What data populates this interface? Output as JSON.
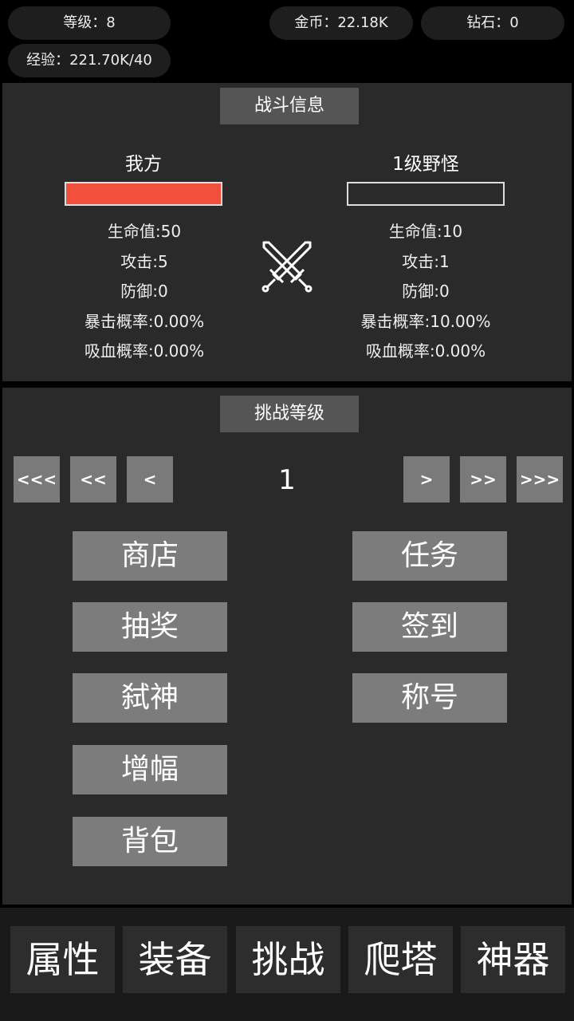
{
  "header": {
    "level": "等级：8",
    "gold": "金币：22.18K",
    "diamond": "钻石：0",
    "exp": "经验：221.70K/40"
  },
  "battle": {
    "title": "战斗信息",
    "player": {
      "name": "我方",
      "hp_fraction": 1.0,
      "hp_color": "#f0503c",
      "stats": [
        "生命值:50",
        "攻击:5",
        "防御:0",
        "暴击概率:0.00%",
        "吸血概率:0.00%"
      ]
    },
    "enemy": {
      "name": "1级野怪",
      "hp_fraction": 0.0,
      "stats": [
        "生命值:10",
        "攻击:1",
        "防御:0",
        "暴击概率:10.00%",
        "吸血概率:0.00%"
      ]
    },
    "center_icon": "crossed-swords-icon"
  },
  "challenge": {
    "title": "挑战等级",
    "nav": {
      "first": "<<<",
      "prev10": "<<",
      "prev": "<",
      "next": ">",
      "next10": ">>",
      "last": ">>>"
    },
    "level": "1"
  },
  "menu": {
    "left": [
      "商店",
      "抽奖",
      "弑神",
      "增幅",
      "背包"
    ],
    "right": [
      "任务",
      "签到",
      "称号"
    ]
  },
  "tabs": [
    "属性",
    "装备",
    "挑战",
    "爬塔",
    "神器"
  ]
}
